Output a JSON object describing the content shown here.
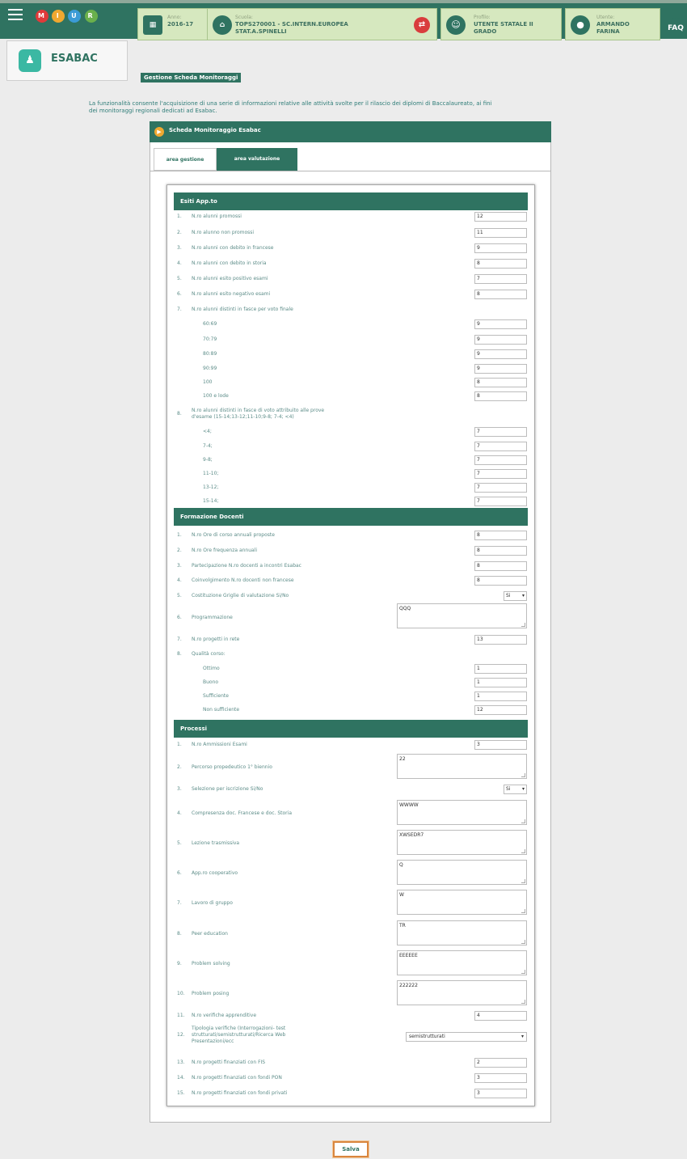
{
  "header": {
    "logo_letters": [
      "M",
      "I",
      "U",
      "R"
    ],
    "anno": {
      "label": "Anno:",
      "value": "2016-17"
    },
    "scuola": {
      "label": "Scuola:",
      "value_line1": "TOPS270001 - SC.INTERN.EUROPEA",
      "value_line2": "STAT.A.SPINELLI"
    },
    "profilo": {
      "label": "Profilo:",
      "value_line1": "UTENTE STATALE II",
      "value_line2": "GRADO"
    },
    "utente": {
      "label": "Utente:",
      "value_line1": "ARMANDO",
      "value_line2": "FARINA"
    },
    "faq": "FAQ"
  },
  "app": {
    "name": "ESABAC"
  },
  "page_title": "Gestione Scheda Monitoraggi",
  "intro_line1": "La funzionalità consente l'acquisizione di una serie di informazioni relative alle attività svolte per il rilascio dei diplomi di Baccalaureato, ai fini",
  "intro_line2": "dei monitoraggi regionali dedicati ad Esabac.",
  "panel_title": "Scheda Monitoraggio Esabac",
  "tabs": {
    "gestione": "area gestione",
    "valutazione": "area valutazione"
  },
  "esiti": {
    "title": "Esiti App.to",
    "items": [
      {
        "num": "1.",
        "label": "N.ro alunni promossi",
        "value": "12"
      },
      {
        "num": "2.",
        "label": "N.ro alunno non promossi",
        "value": "11"
      },
      {
        "num": "3.",
        "label": "N.ro alunni con debito in francese",
        "value": "9"
      },
      {
        "num": "4.",
        "label": "N.ro alunni con debito in storia",
        "value": "8"
      },
      {
        "num": "5.",
        "label": "N.ro alunni esito positivo esami",
        "value": "7"
      },
      {
        "num": "6.",
        "label": "N.ro alunni esito negativo esami",
        "value": "8"
      },
      {
        "num": "7.",
        "label": "N.ro alunni distinti in fasce per voto finale"
      }
    ],
    "fasce_voto": [
      {
        "label": "60:69",
        "value": "9"
      },
      {
        "label": "70:79",
        "value": "9"
      },
      {
        "label": "80:89",
        "value": "9"
      },
      {
        "label": "90:99",
        "value": "9"
      },
      {
        "label": "100",
        "value": "8"
      },
      {
        "label": "100 e lode",
        "value": "8"
      }
    ],
    "item8": {
      "num": "8.",
      "label_line1": "N.ro alunni distinti in fasce di voto attribuito alle prove",
      "label_line2": "d'esame (15-14;13-12;11-10;9-8; 7-4; <4)"
    },
    "fasce_prove": [
      {
        "label": "<4;",
        "value": "7"
      },
      {
        "label": "7-4;",
        "value": "7"
      },
      {
        "label": "9-8;",
        "value": "7"
      },
      {
        "label": "11-10;",
        "value": "7"
      },
      {
        "label": "13-12;",
        "value": "7"
      },
      {
        "label": "15-14;",
        "value": "7"
      }
    ]
  },
  "formazione": {
    "title": "Formazione Docenti",
    "items": [
      {
        "num": "1.",
        "label": "N.ro Ore di corso annuali proposte",
        "value": "8"
      },
      {
        "num": "2.",
        "label": "N.ro Ore frequenza annuali",
        "value": "8"
      },
      {
        "num": "3.",
        "label": "Partecipazione N.ro docenti a incontri Esabac",
        "value": "8"
      },
      {
        "num": "4.",
        "label": "Coinvolgimento N.ro docenti non francese",
        "value": "8"
      }
    ],
    "item5": {
      "num": "5.",
      "label": "Costituzione Griglie di valutazione Si/No",
      "value": "Si"
    },
    "item6": {
      "num": "6.",
      "label": "Programmazione",
      "value": "QQQ"
    },
    "item7": {
      "num": "7.",
      "label": "N.ro progetti in rete",
      "value": "13"
    },
    "item8": {
      "num": "8.",
      "label": "Qualità corso:"
    },
    "qualita": [
      {
        "label": "Ottimo",
        "value": "1"
      },
      {
        "label": "Buono",
        "value": "1"
      },
      {
        "label": "Sufficiente",
        "value": "1"
      },
      {
        "label": "Non sufficiente",
        "value": "12"
      }
    ]
  },
  "processi": {
    "title": "Processi",
    "item1": {
      "num": "1.",
      "label": "N.ro Ammissioni Esami",
      "value": "3"
    },
    "item2": {
      "num": "2.",
      "label": "Percorso propedeutico 1° biennio",
      "value": "22"
    },
    "item3": {
      "num": "3.",
      "label": "Selezione per iscrizione Si/No",
      "value": "Si"
    },
    "textareas": [
      {
        "num": "4.",
        "label": "Compresenza doc. Francese e doc. Storia",
        "value": "WWWW"
      },
      {
        "num": "5.",
        "label": "Lezione trasmissiva",
        "value": "XWSEDR7"
      },
      {
        "num": "6.",
        "label": "App.ro cooperativo",
        "value": "Q"
      },
      {
        "num": "7.",
        "label": "Lavoro di gruppo",
        "value": "W"
      },
      {
        "num": "8.",
        "label": "Peer education",
        "value": "TR"
      },
      {
        "num": "9.",
        "label": "Problem solving",
        "value": "EEEEEE"
      },
      {
        "num": "10.",
        "label": "Problem posing",
        "value": "222222"
      }
    ],
    "item11": {
      "num": "11.",
      "label": "N.ro verifiche apprenditive",
      "value": "4"
    },
    "item12": {
      "num": "12.",
      "label_line1": "Tipologia verifiche (Interrogazioni- test",
      "label_line2": "strutturati/semistrutturati/Ricerca Web",
      "label_line3": "Presentazioni/ecc",
      "value": "semistrutturati"
    },
    "tail": [
      {
        "num": "13.",
        "label": "N.ro progetti finanziati con FIS",
        "value": "2"
      },
      {
        "num": "14.",
        "label": "N.ro progetti finanziati con fondi PON",
        "value": "3"
      },
      {
        "num": "15.",
        "label": "N.ro progetti finanziati con fondi privati",
        "value": "3"
      }
    ]
  },
  "save_label": "Salva",
  "colors": {
    "primary": "#2f7361",
    "info_box": "#d6e8bf",
    "accent_btn": "#d9863e"
  }
}
